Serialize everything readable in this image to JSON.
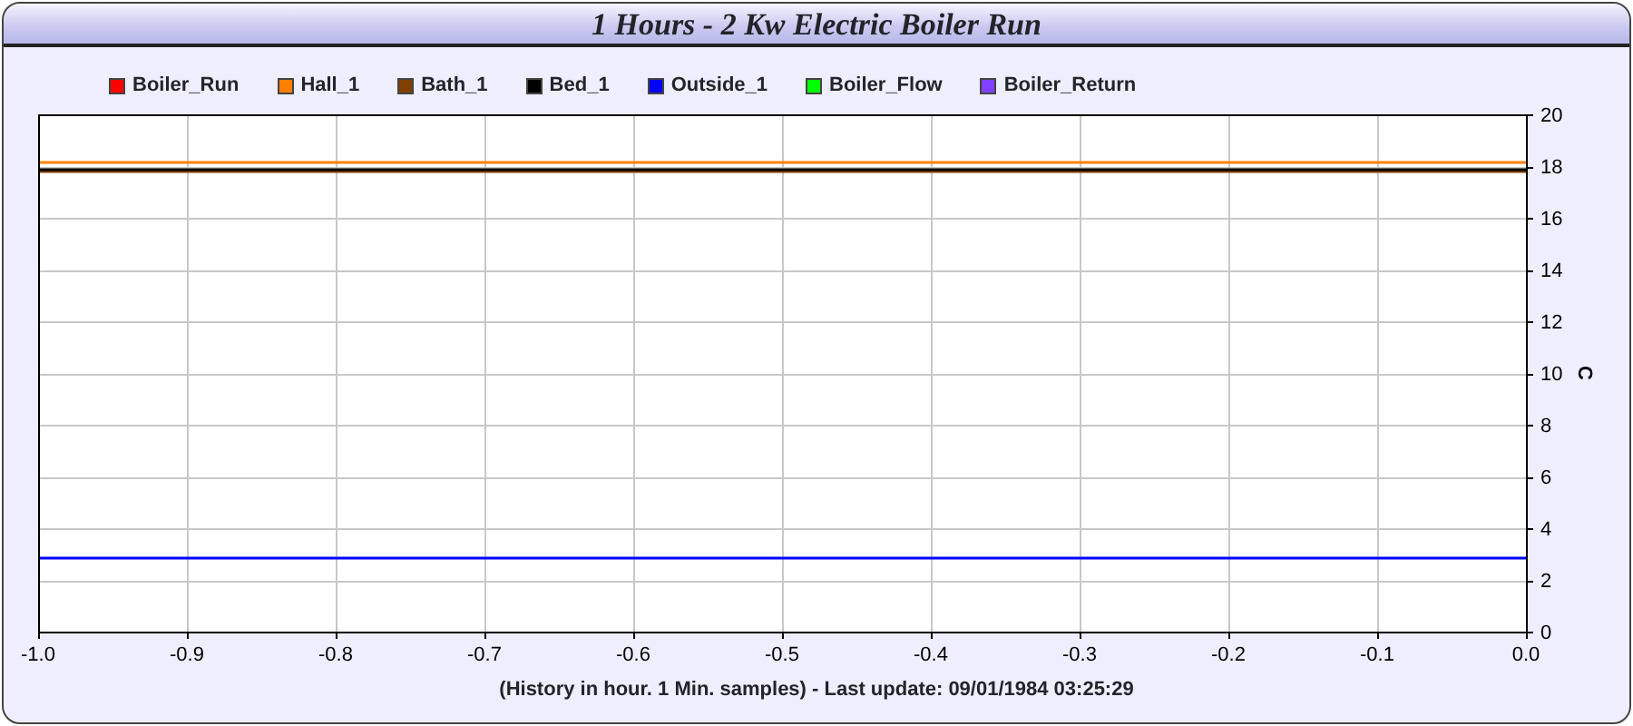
{
  "chart_data": {
    "type": "line",
    "title": "1 Hours - 2 Kw Electric Boiler Run",
    "ylabel": "C",
    "x": [
      -1.0,
      0.0
    ],
    "xlim": [
      -1.0,
      0.0
    ],
    "ylim": [
      0,
      20
    ],
    "grid": true,
    "xticks": [
      {
        "value": -1.0,
        "label": "-1.0"
      },
      {
        "value": -0.9,
        "label": "-0.9"
      },
      {
        "value": -0.8,
        "label": "-0.8"
      },
      {
        "value": -0.7,
        "label": "-0.7"
      },
      {
        "value": -0.6,
        "label": "-0.6"
      },
      {
        "value": -0.5,
        "label": "-0.5"
      },
      {
        "value": -0.4,
        "label": "-0.4"
      },
      {
        "value": -0.3,
        "label": "-0.3"
      },
      {
        "value": -0.2,
        "label": "-0.2"
      },
      {
        "value": -0.1,
        "label": "-0.1"
      },
      {
        "value": 0.0,
        "label": "0.0"
      }
    ],
    "yticks": [
      0,
      2,
      4,
      6,
      8,
      10,
      12,
      14,
      16,
      18,
      20
    ],
    "series": [
      {
        "name": "Boiler_Run",
        "color": "#ff0000",
        "values": [
          null,
          null
        ]
      },
      {
        "name": "Hall_1",
        "color": "#ff8000",
        "values": [
          18.2,
          18.2
        ]
      },
      {
        "name": "Bath_1",
        "color": "#804000",
        "values": [
          17.8,
          17.8
        ]
      },
      {
        "name": "Bed_1",
        "color": "#000000",
        "values": [
          17.9,
          17.9
        ]
      },
      {
        "name": "Outside_1",
        "color": "#0000ff",
        "values": [
          2.9,
          2.9
        ]
      },
      {
        "name": "Boiler_Flow",
        "color": "#00ff00",
        "values": [
          null,
          null
        ]
      },
      {
        "name": "Boiler_Return",
        "color": "#8040ff",
        "values": [
          null,
          null
        ]
      }
    ]
  },
  "footer": "(History in hour. 1 Min. samples) - Last update: 09/01/1984 03:25:29"
}
